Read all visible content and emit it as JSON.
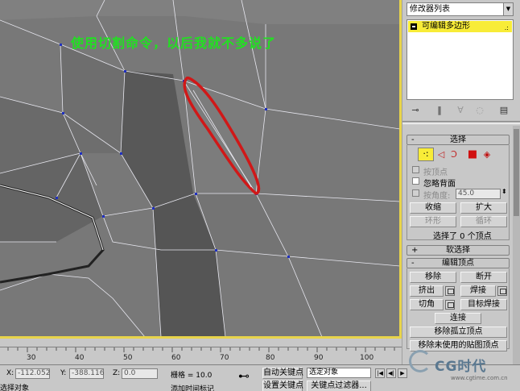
{
  "annotation": "使用切割命令，以后我就不多说了",
  "panel": {
    "modifier_list": "修改器列表",
    "stack_item": "可编辑多边形",
    "stack_dots": ".:",
    "selection": {
      "header": "选择",
      "by_vertex": "按顶点",
      "ignore_backfacing": "忽略背面",
      "by_angle": "按角度:",
      "angle_value": "45.0",
      "shrink": "收缩",
      "grow": "扩大",
      "ring": "环形",
      "loop": "循环",
      "status": "选择了 0 个顶点"
    },
    "soft_selection": {
      "header": "软选择"
    },
    "edit_vertices": {
      "header": "编辑顶点",
      "remove": "移除",
      "break": "断开",
      "extrude": "挤出",
      "weld": "焊接",
      "chamfer": "切角",
      "target_weld": "目标焊接",
      "connect": "连接",
      "remove_isolated": "移除孤立顶点",
      "remove_unused_map": "移除未使用的贴图顶点"
    }
  },
  "timeline": {
    "ticks": [
      "30",
      "40",
      "50",
      "60",
      "70",
      "80",
      "90",
      "100"
    ]
  },
  "status": {
    "selection_label": "选择对象",
    "x_label": "X:",
    "x_value": "-112.052",
    "y_label": "Y:",
    "y_value": "-388.116",
    "z_label": "Z:",
    "z_value": "0.0",
    "grid": "栅格 = 10.0",
    "auto_key": "自动关键点",
    "selected_object": "选定对象",
    "set_key": "设置关键点",
    "key_filters": "关键点过滤器...",
    "add_time_tag": "添加时间标记"
  },
  "watermark": {
    "brand": "CG时代",
    "url": "www.cgtime.com.cn"
  },
  "colors": {
    "viewport_bg": "#787878",
    "active_border": "#e8d44a",
    "annotation": "#22e022",
    "highlight_stroke": "#d01818",
    "stack_highlight": "#f8ec38"
  }
}
